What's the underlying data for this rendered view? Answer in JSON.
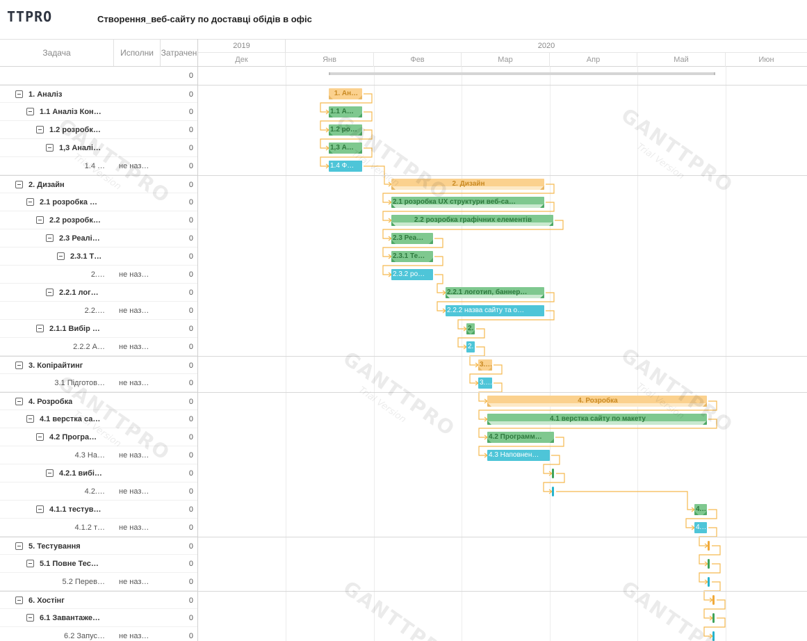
{
  "brand": {
    "logo_text": "TTPRO"
  },
  "project": {
    "title": "Створення_веб-сайту  по доставці  обідів в офіс"
  },
  "columns": {
    "task": "Задача",
    "assignee": "Исполни",
    "cost": "Затрачен"
  },
  "timeline": {
    "years": [
      "2019",
      "2020"
    ],
    "months": [
      "Дек",
      "Янв",
      "Фев",
      "Мар",
      "Апр",
      "Май",
      "Июн"
    ]
  },
  "watermark": {
    "main": "GANTTPRO",
    "sub": "Trial Version"
  },
  "tasks": [
    {
      "name": "",
      "assignee": "",
      "cost": "0"
    },
    {
      "name": "1. Аналіз",
      "assignee": "",
      "cost": "0"
    },
    {
      "name": "1.1 Аналіз Кон…",
      "assignee": "",
      "cost": "0"
    },
    {
      "name": "1.2 розробк…",
      "assignee": "",
      "cost": "0"
    },
    {
      "name": "1,3 Аналі…",
      "assignee": "",
      "cost": "0"
    },
    {
      "name": "1.4 …",
      "assignee": "не наз…",
      "cost": "0"
    },
    {
      "name": "2. Дизайн",
      "assignee": "",
      "cost": "0"
    },
    {
      "name": "2.1 розробка …",
      "assignee": "",
      "cost": "0"
    },
    {
      "name": "2.2 розробк…",
      "assignee": "",
      "cost": "0"
    },
    {
      "name": "2.3 Реалі…",
      "assignee": "",
      "cost": "0"
    },
    {
      "name": "2.3.1 Т…",
      "assignee": "",
      "cost": "0"
    },
    {
      "name": "2.…",
      "assignee": "не наз…",
      "cost": "0"
    },
    {
      "name": "2.2.1 лог…",
      "assignee": "",
      "cost": "0"
    },
    {
      "name": "2.2.…",
      "assignee": "не наз…",
      "cost": "0"
    },
    {
      "name": "2.1.1 Вибір …",
      "assignee": "",
      "cost": "0"
    },
    {
      "name": "2.2.2 А…",
      "assignee": "не наз…",
      "cost": "0"
    },
    {
      "name": "3. Копірайтинг",
      "assignee": "",
      "cost": "0"
    },
    {
      "name": "3.1 Підготов…",
      "assignee": "не наз…",
      "cost": "0"
    },
    {
      "name": "4. Розробка",
      "assignee": "",
      "cost": "0"
    },
    {
      "name": "4.1 верстка са…",
      "assignee": "",
      "cost": "0"
    },
    {
      "name": "4.2 Програ…",
      "assignee": "",
      "cost": "0"
    },
    {
      "name": "4.3 На…",
      "assignee": "не наз…",
      "cost": "0"
    },
    {
      "name": "4.2.1 вибі…",
      "assignee": "",
      "cost": "0"
    },
    {
      "name": "4.2.…",
      "assignee": "не наз…",
      "cost": "0"
    },
    {
      "name": "4.1.1 тестув…",
      "assignee": "",
      "cost": "0"
    },
    {
      "name": "4.1.2 т…",
      "assignee": "не наз…",
      "cost": "0"
    },
    {
      "name": "5. Тестування",
      "assignee": "",
      "cost": "0"
    },
    {
      "name": "5.1 Повне Тес…",
      "assignee": "",
      "cost": "0"
    },
    {
      "name": "5.2 Перев…",
      "assignee": "не наз…",
      "cost": "0"
    },
    {
      "name": "6. Хостінг",
      "assignee": "",
      "cost": "0"
    },
    {
      "name": "6.1 Завантаже…",
      "assignee": "",
      "cost": "0"
    },
    {
      "name": "6.2 Запус…",
      "assignee": "не наз…",
      "cost": "0"
    }
  ],
  "bars": [
    {
      "label": ""
    },
    {
      "label": "1. Ан…"
    },
    {
      "label": "1.1 А…"
    },
    {
      "label": "1.2 ро…"
    },
    {
      "label": "1,3 А…"
    },
    {
      "label": "1.4 Ф…"
    },
    {
      "label": "2. Дизайн"
    },
    {
      "label": "2.1 розробка UX структури веб-са…"
    },
    {
      "label": "2.2 розробка графічних елементів"
    },
    {
      "label": "2.3 Реа…"
    },
    {
      "label": "2.3.1 Те…"
    },
    {
      "label": "2.3.2 ро…"
    },
    {
      "label": "2.2.1 логотип, баннер…"
    },
    {
      "label": "2.2.2 назва сайту та о…"
    },
    {
      "label": "2."
    },
    {
      "label": "2."
    },
    {
      "label": "3.…"
    },
    {
      "label": "3.…"
    },
    {
      "label": "4. Розробка"
    },
    {
      "label": "4.1 верстка сайту по макету"
    },
    {
      "label": "4.2 Программ…"
    },
    {
      "label": "4.3 Наповнен…"
    },
    {
      "label": ""
    },
    {
      "label": ""
    },
    {
      "label": "4.…"
    },
    {
      "label": "4.…"
    },
    {
      "label": ""
    },
    {
      "label": ""
    },
    {
      "label": ""
    },
    {
      "label": ""
    },
    {
      "label": ""
    },
    {
      "label": ""
    }
  ],
  "colors": {
    "summary_orange": "#fbd18e",
    "summary_green": "#7fc88f",
    "task_blue": "#4ec5d8",
    "link_orange": "#f5b94f"
  }
}
